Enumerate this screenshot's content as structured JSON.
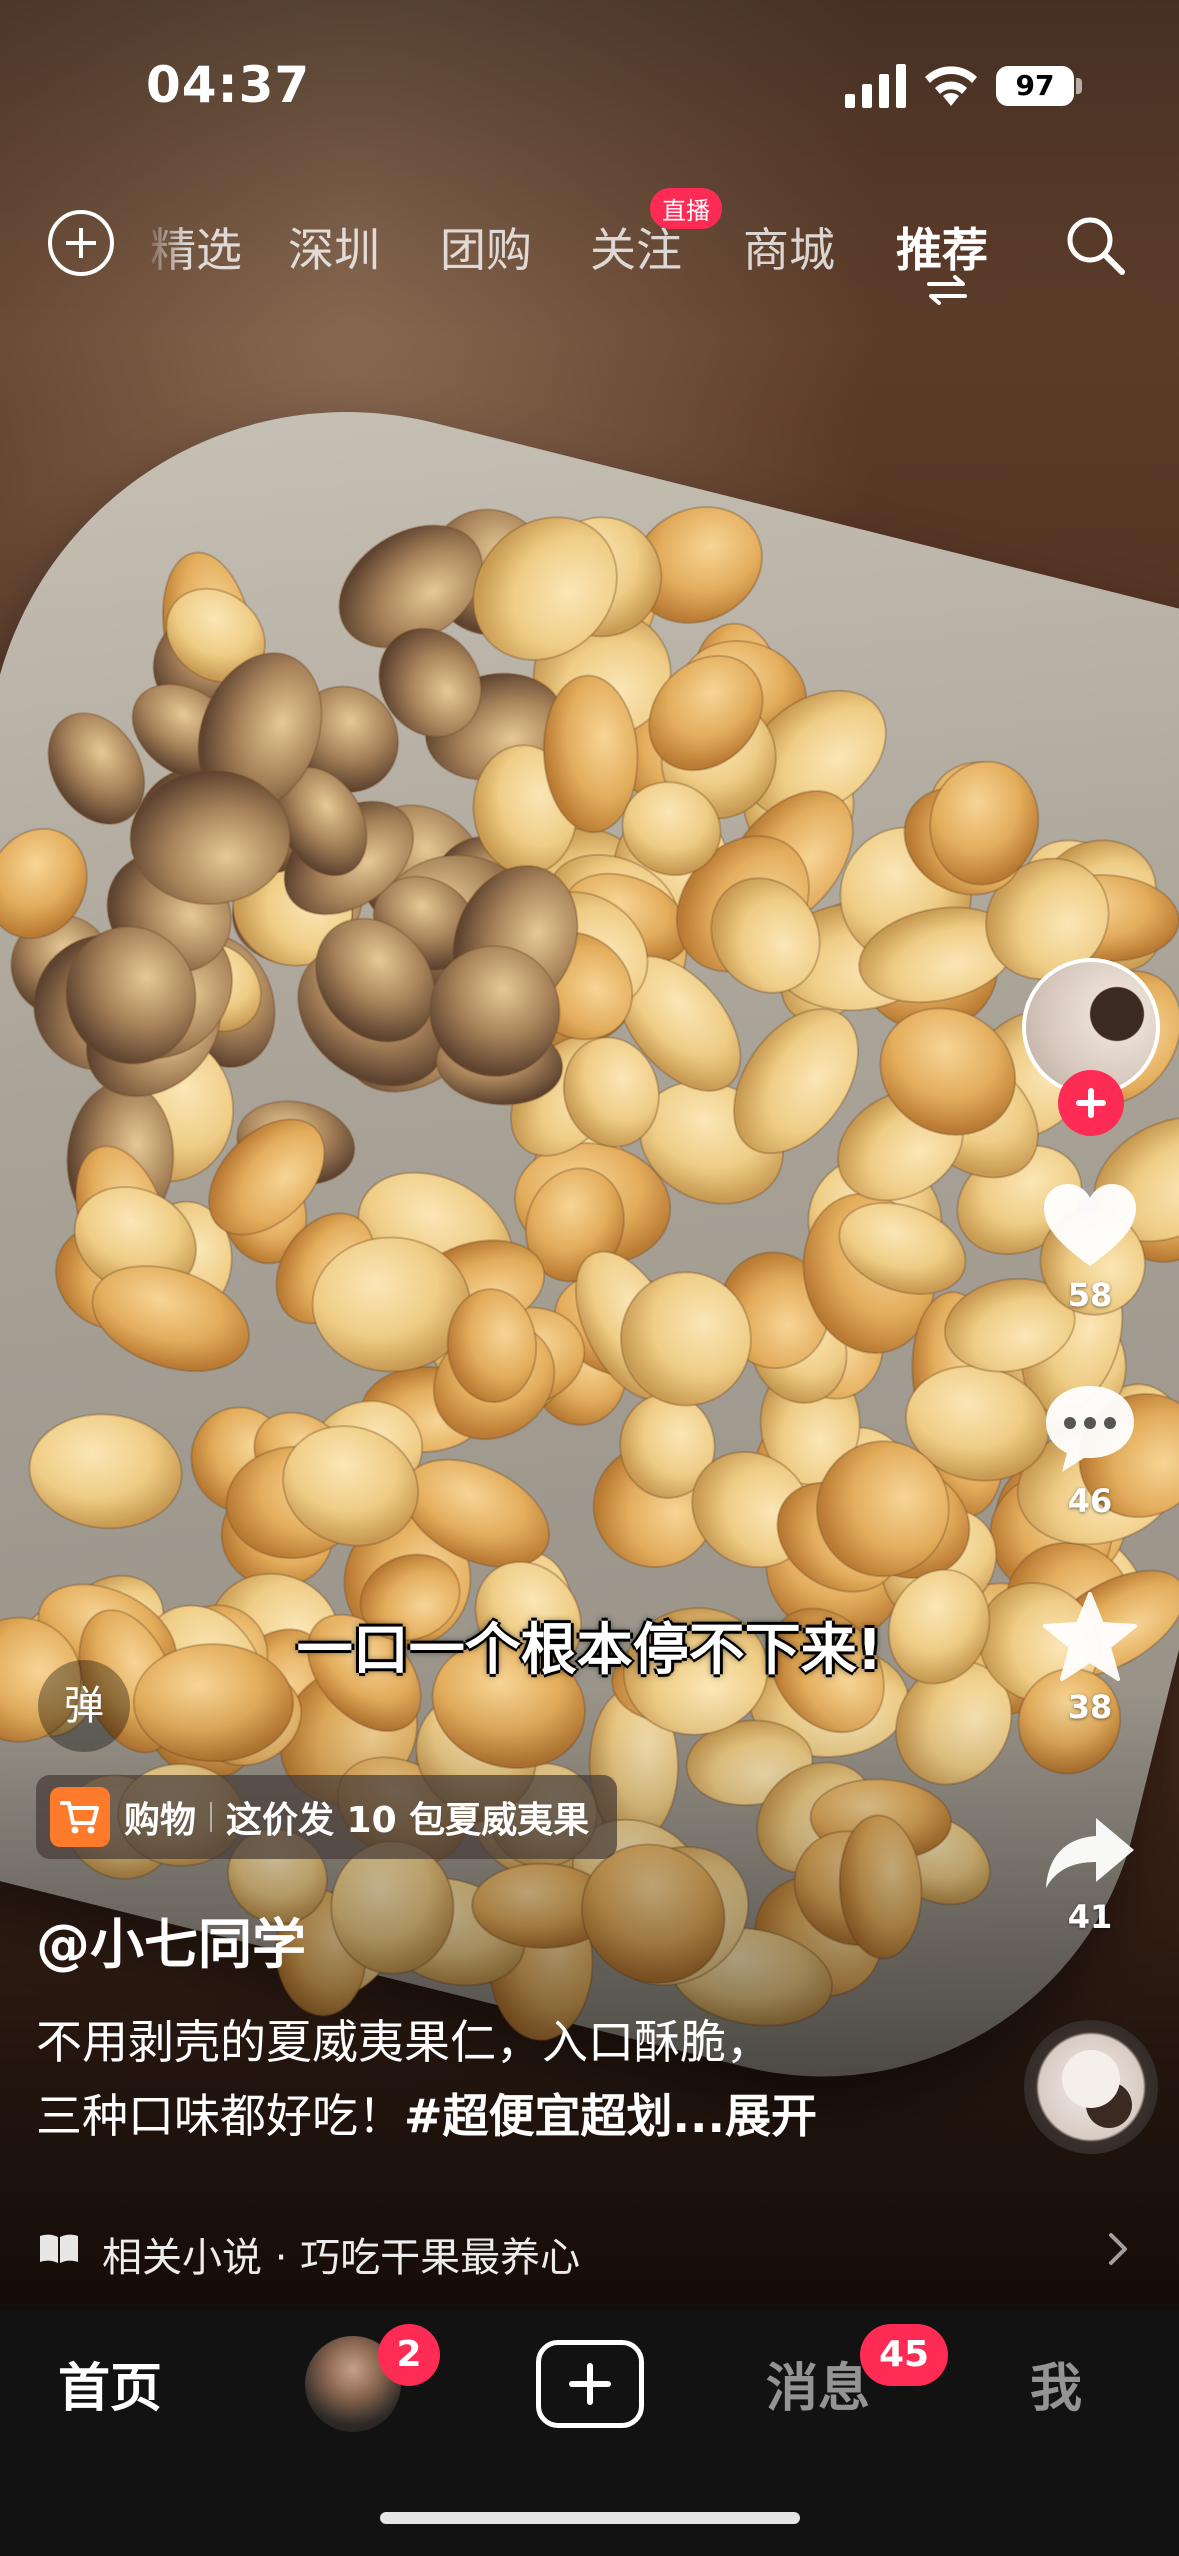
{
  "status_bar": {
    "time": "04:37",
    "battery": "97"
  },
  "top_nav": {
    "tabs": [
      "精选",
      "深圳",
      "团购",
      "关注",
      "商城",
      "推荐"
    ],
    "active_tab": "推荐",
    "live_badge": "直播"
  },
  "video": {
    "subtitle": "一口一个根本停不下来!",
    "danmu_label": "弹"
  },
  "actions": {
    "like_count": "58",
    "comment_count": "46",
    "favorite_count": "38",
    "share_count": "41"
  },
  "shop": {
    "label": "购物",
    "text": "这价发 10 包夏威夷果"
  },
  "post": {
    "author": "@小七同学",
    "desc_line1": "不用剥壳的夏威夷果仁，入口酥脆，",
    "desc_line2_text": "三种口味都好吃！",
    "desc_line2_tag": "#超便宜超划...",
    "expand_label": "展开"
  },
  "related": {
    "text": "相关小说 · 巧吃干果最养心"
  },
  "tab_bar": {
    "home": "首页",
    "friends_badge": "2",
    "messages": "消息",
    "messages_badge": "45",
    "me": "我"
  },
  "colors": {
    "accent": "#fe2c55",
    "cart": "#ff7a2b",
    "tab_bar_bg": "#121212"
  }
}
